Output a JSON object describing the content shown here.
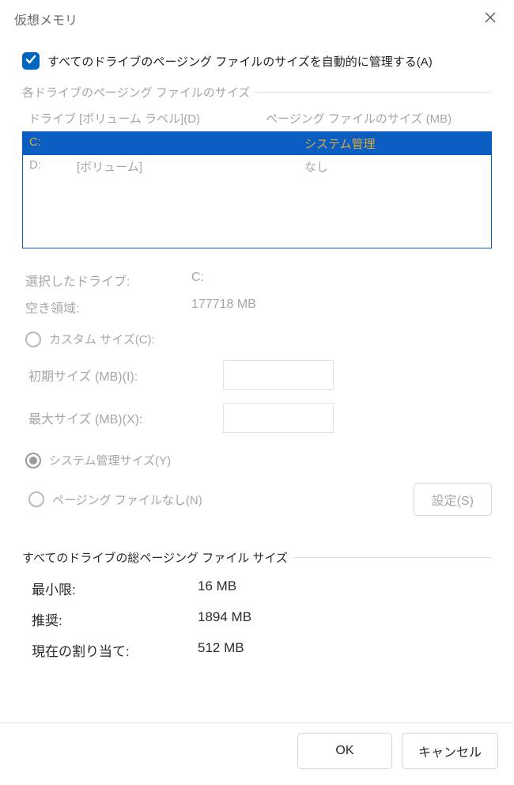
{
  "window": {
    "title": "仮想メモリ"
  },
  "auto_manage": {
    "checked": true,
    "label": "すべてのドライブのページング ファイルのサイズを自動的に管理する(A)"
  },
  "drives_section": {
    "title": "各ドライブのページング ファイルのサイズ",
    "header_drive": "ドライブ  [ボリューム ラベル](D)",
    "header_size": "ページング ファイルのサイズ (MB)",
    "rows": [
      {
        "letter": "C:",
        "label": "",
        "size": "システム管理",
        "selected": true
      },
      {
        "letter": "D:",
        "label": "[ボリューム]",
        "size": "なし",
        "selected": false
      }
    ]
  },
  "selected_drive": {
    "label": "選択したドライブ:",
    "value": "C:",
    "free_label": "空き領域:",
    "free_value": "177718 MB"
  },
  "custom_size": {
    "radio_label": "カスタム サイズ(C):",
    "initial_label": "初期サイズ (MB)(I):",
    "initial_value": "",
    "max_label": "最大サイズ (MB)(X):",
    "max_value": ""
  },
  "system_managed": {
    "radio_label": "システム管理サイズ(Y)",
    "selected": true
  },
  "no_paging": {
    "radio_label": "ページング ファイルなし(N)"
  },
  "set_button": "設定(S)",
  "totals": {
    "title": "すべてのドライブの総ページング ファイル サイズ",
    "min_label": "最小限:",
    "min_value": "16 MB",
    "rec_label": "推奨:",
    "rec_value": "1894 MB",
    "cur_label": "現在の割り当て:",
    "cur_value": "512 MB"
  },
  "buttons": {
    "ok": "OK",
    "cancel": "キャンセル"
  }
}
